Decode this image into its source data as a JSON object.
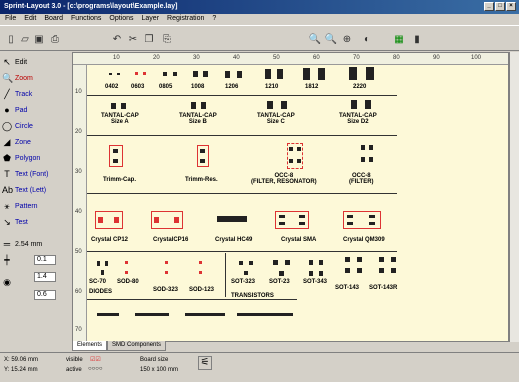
{
  "window": {
    "title": "Sprint-Layout 3.0 - [c:\\programs\\layout\\Example.lay]",
    "btn_min": "_",
    "btn_max": "□",
    "btn_close": "×"
  },
  "menu": [
    "File",
    "Edit",
    "Board",
    "Functions",
    "Options",
    "Layer",
    "Registration",
    "?"
  ],
  "toolbar": {
    "icons": [
      "new-icon",
      "open-icon",
      "save-icon",
      "print-icon",
      "undo-icon",
      "cut-icon",
      "copy-icon",
      "paste-icon",
      "zoom-in-icon",
      "zoom-out-icon",
      "zoom-fit-icon",
      "moon-icon",
      "grid-icon",
      "component-icon"
    ]
  },
  "tools": [
    {
      "label": "Edit",
      "icon": "arrow"
    },
    {
      "label": "Zoom",
      "icon": "zoom"
    },
    {
      "label": "Track",
      "icon": "track"
    },
    {
      "label": "Pad",
      "icon": "pad"
    },
    {
      "label": "Circle",
      "icon": "circle"
    },
    {
      "label": "Zone",
      "icon": "zone"
    },
    {
      "label": "Polygon",
      "icon": "polygon"
    },
    {
      "label": "Text (Font)",
      "icon": "text"
    },
    {
      "label": "Text (Lett)",
      "icon": "text-lett"
    },
    {
      "label": "Pattern",
      "icon": "pattern"
    },
    {
      "label": "Test",
      "icon": "test"
    }
  ],
  "settings": {
    "track_width": "2.54 mm",
    "spin1": "0.1",
    "spin2": "1.4",
    "spin3": "0.6"
  },
  "ruler": {
    "h": [
      "10",
      "20",
      "30",
      "40",
      "50",
      "60",
      "70",
      "80",
      "90",
      "100"
    ],
    "v": [
      "10",
      "20",
      "30",
      "40",
      "50",
      "60",
      "70"
    ]
  },
  "rows": [
    {
      "labels": [
        "0402",
        "0603",
        "0805",
        "1008",
        "1206",
        "1210",
        "1812",
        "2220"
      ]
    },
    {
      "labels": [
        "TANTAL-CAP\nSize A",
        "TANTAL-CAP\nSize B",
        "TANTAL-CAP\nSize C",
        "TANTAL-CAP\nSize D2"
      ]
    },
    {
      "labels": [
        "Trimm-Cap.",
        "Trimm-Res.",
        "OCC-8\n(FILTER, RESONATOR)",
        "OCC-8\n(FILTER)"
      ]
    },
    {
      "labels": [
        "Crystal CP12",
        "CrystalCP16",
        "Crystal HC49",
        "Crystal SMA",
        "Crystal QM309"
      ]
    },
    {
      "labels": [
        "SC-70",
        "SOD-80",
        "SOD-323",
        "SOD-123",
        "SOT-323",
        "SOT-23",
        "SOT-343",
        "SOT-143",
        "SOT-143R"
      ]
    },
    {
      "labels": [
        "DIODES",
        "TRANSISTORS"
      ]
    }
  ],
  "tabs": [
    "Elements",
    "SMD Components"
  ],
  "status": {
    "x": "X: 59.06 mm",
    "y": "Y: 15.24 mm",
    "visible": "visible",
    "active": "active",
    "board_size_label": "Board size",
    "board_size": "150 x 100 mm"
  },
  "colors": {
    "sheet": "#fdf9d8",
    "title_start": "#0a246a",
    "pad": "#222222",
    "selected": "#dd3333"
  }
}
